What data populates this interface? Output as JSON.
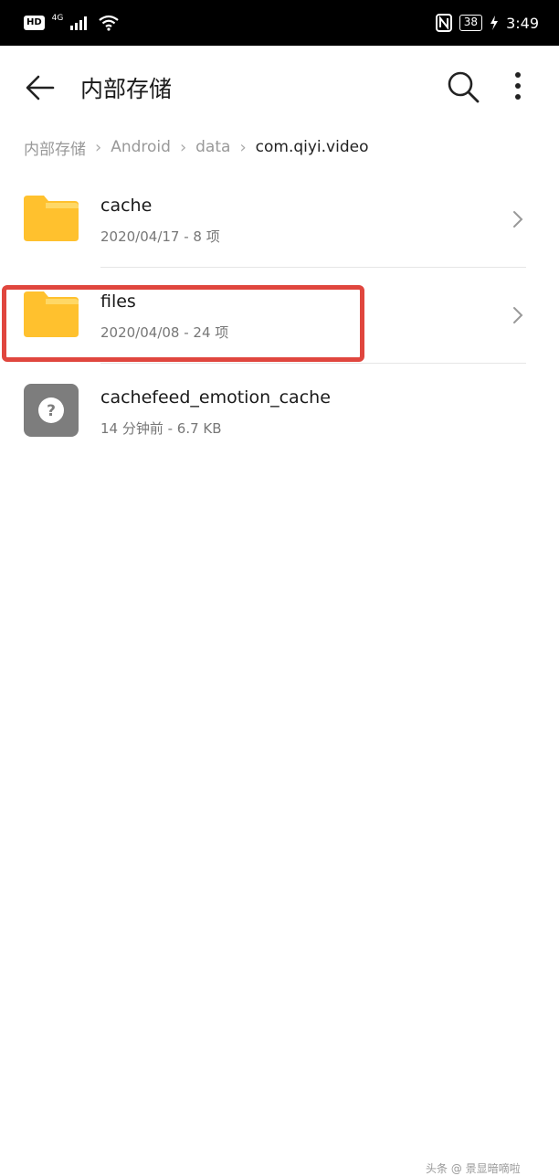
{
  "status_bar": {
    "hd": "HD",
    "network": "4G",
    "battery": "38",
    "time": "3:49"
  },
  "app_bar": {
    "title": "内部存储",
    "back_icon": "arrow-left-icon",
    "search_icon": "search-icon",
    "more_icon": "more-vertical-icon"
  },
  "breadcrumb": [
    "内部存储",
    "Android",
    "data",
    "com.qiyi.video"
  ],
  "files": [
    {
      "name": "cache",
      "meta": "2020/04/17 - 8 项",
      "type": "folder"
    },
    {
      "name": "files",
      "meta": "2020/04/08 - 24 项",
      "type": "folder"
    },
    {
      "name": "cachefeed_emotion_cache",
      "meta": "14 分钟前 - 6.7 KB",
      "type": "unknown"
    }
  ],
  "colors": {
    "folder": "#FFC12E",
    "folder_tab": "#FFD866",
    "highlight": "#E0463E",
    "unknown_file": "#7D7D7D"
  },
  "watermark": "头条 @ 景显暗嘀啦"
}
